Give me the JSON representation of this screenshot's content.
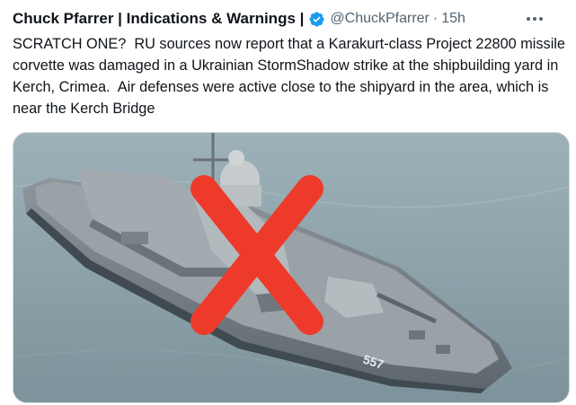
{
  "tweet": {
    "display_name": "Chuck Pfarrer | Indications & Warnings |",
    "handle": "@ChuckPfarrer",
    "separator": "·",
    "time": "15h",
    "text": "SCRATCH ONE?  RU sources now report that a Karakurt-class Project 22800 missile corvette was damaged in a Ukrainian StormShadow strike at the shipbuilding yard in Kerch, Crimea.  Air defenses were active close to the shipyard in the area, which is near the Kerch Bridge",
    "icons": {
      "verified": "verified-badge-icon",
      "more": "more-options-icon"
    },
    "colors": {
      "verified": "#1d9bf0",
      "secondary_text": "#536471",
      "cross": "#ee3a2a"
    },
    "media": {
      "description_icon": "red-x-mark"
    }
  }
}
